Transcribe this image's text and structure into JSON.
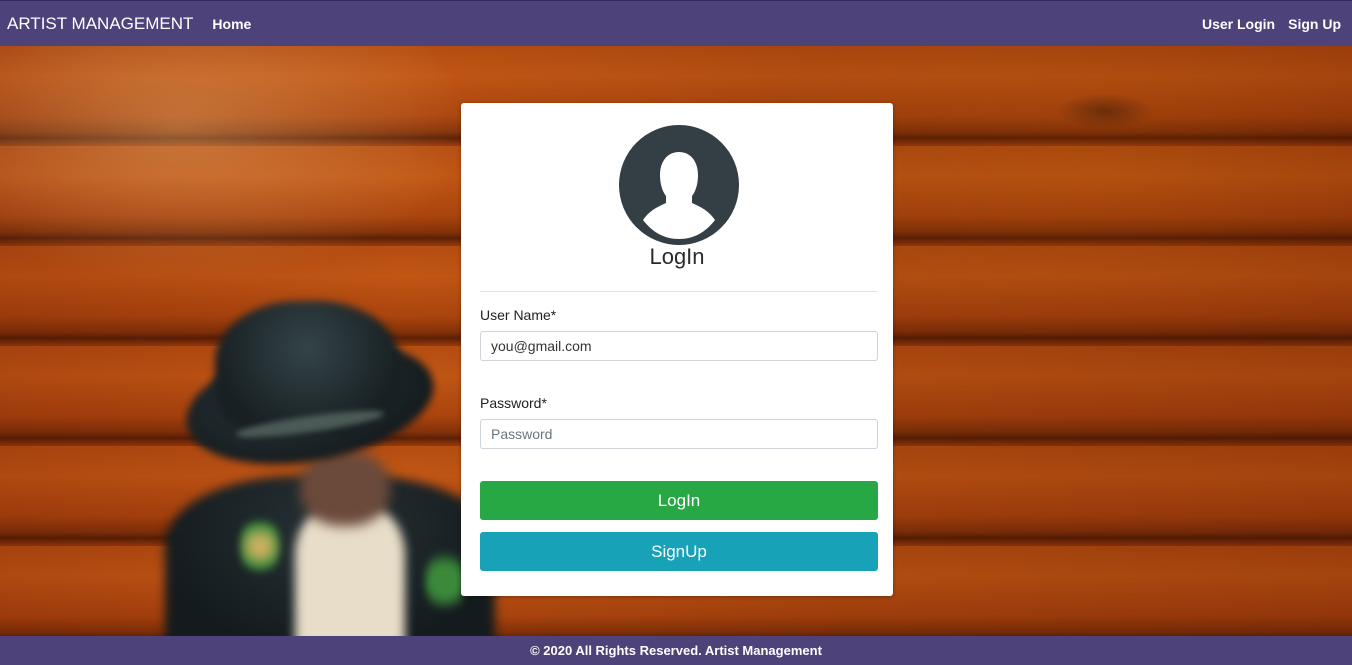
{
  "navbar": {
    "brand": "ARTIST MANAGEMENT",
    "home": "Home",
    "user_login": "User Login",
    "sign_up": "Sign Up"
  },
  "login_card": {
    "title": "LogIn",
    "username": {
      "label": "User Name*",
      "value": "you@gmail.com",
      "placeholder": ""
    },
    "password": {
      "label": "Password*",
      "placeholder": "Password"
    },
    "login_button": "LogIn",
    "signup_button": "SignUp",
    "avatar_icon": "user-silhouette-icon"
  },
  "footer": {
    "text": "© 2020 All Rights Reserved. Artist Management"
  },
  "colors": {
    "navbar": "#4d427a",
    "login_button": "#28a745",
    "signup_button": "#17a2b8",
    "avatar": "#343e45"
  }
}
